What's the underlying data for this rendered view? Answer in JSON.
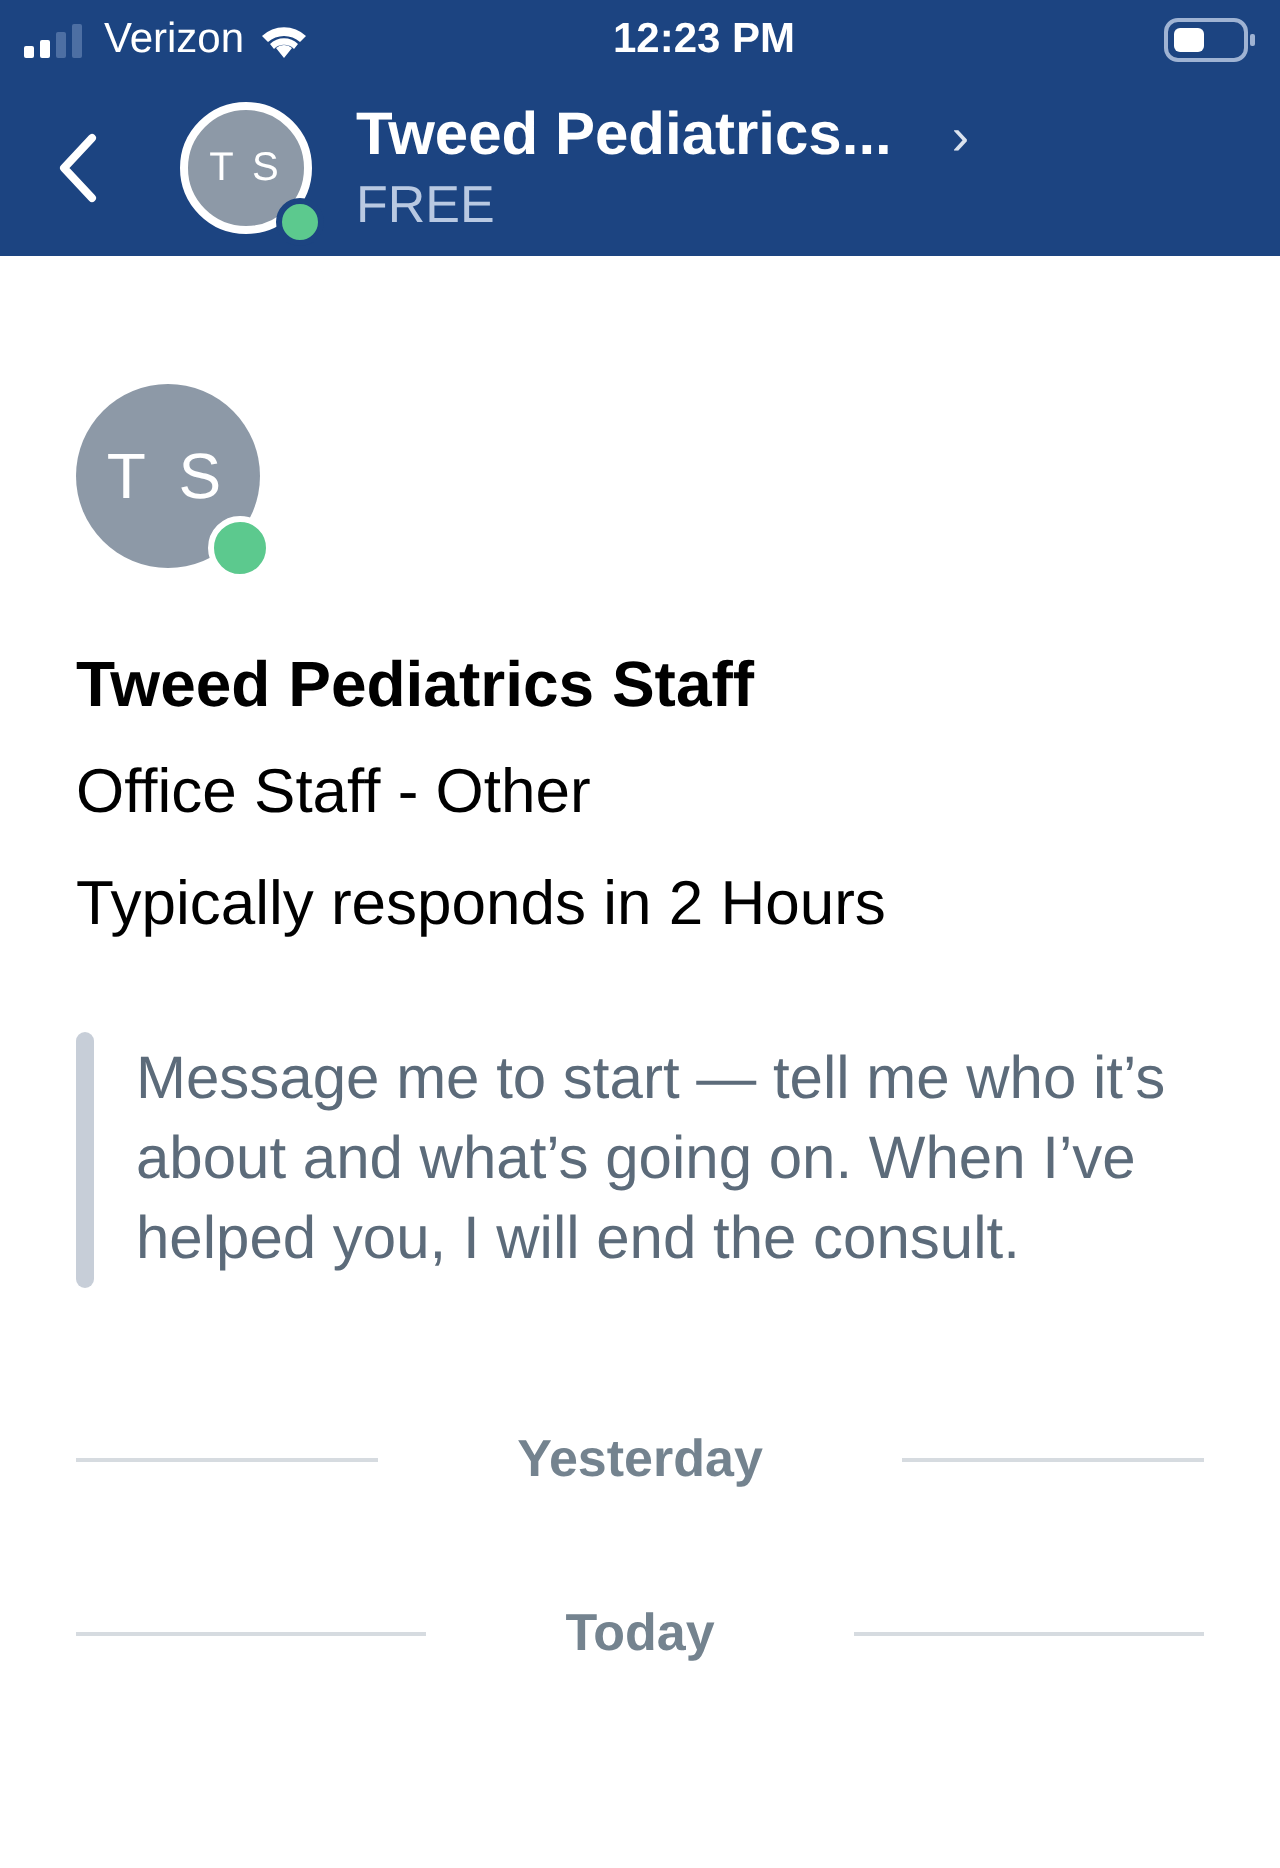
{
  "status_bar": {
    "carrier": "Verizon",
    "time": "12:23 PM"
  },
  "header": {
    "initials": "T S",
    "online": true,
    "title": "Tweed Pediatrics...",
    "subtitle": "FREE",
    "chevron": "›"
  },
  "profile": {
    "initials": "T S",
    "online": true,
    "name": "Tweed Pediatrics Staff",
    "role": "Office Staff - Other",
    "response_time": "Typically responds in 2 Hours"
  },
  "intro_message": "Message me to start — tell me who it’s about and what’s going on. When I’ve helped you, I will end the consult.",
  "day_separators": [
    "Yesterday",
    "Today"
  ]
}
